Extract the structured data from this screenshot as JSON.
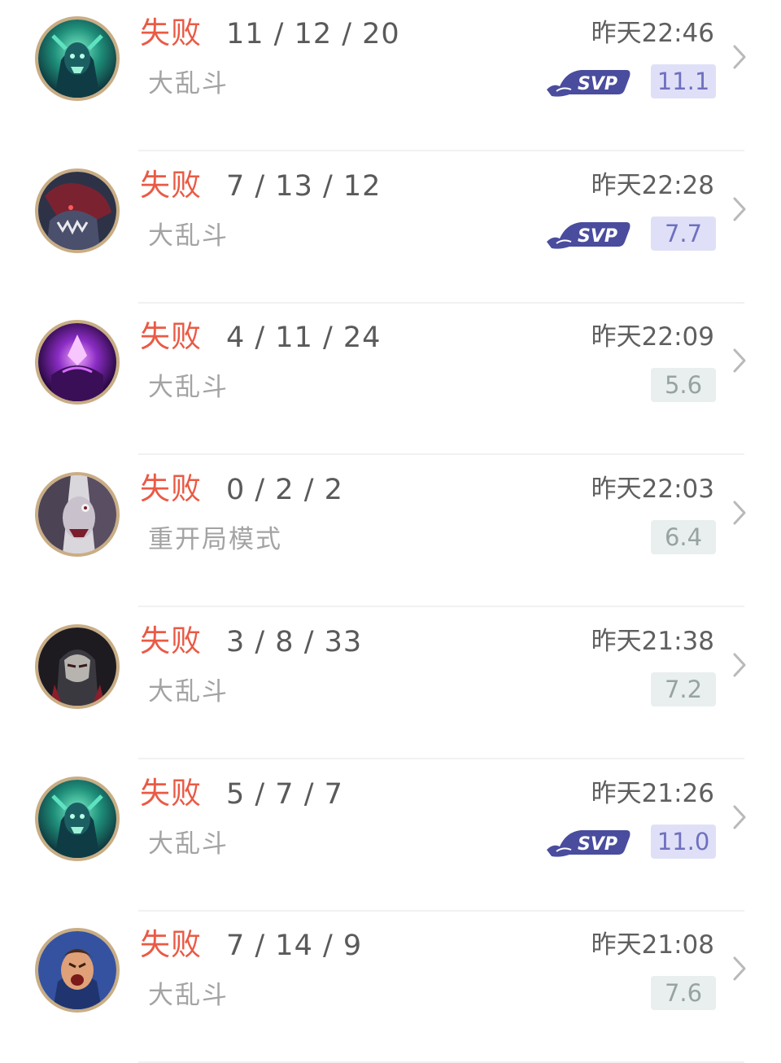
{
  "matches": [
    {
      "result": "失败",
      "kda": "11 / 12 / 20",
      "mode": "大乱斗",
      "time": "昨天22:46",
      "score": "11.1",
      "svp": true,
      "svp_label": "SVP",
      "hero_icon": "green-undead-knight-icon"
    },
    {
      "result": "失败",
      "kda": "7 / 13 / 12",
      "mode": "大乱斗",
      "time": "昨天22:28",
      "score": "7.7",
      "svp": true,
      "svp_label": "SVP",
      "hero_icon": "red-beast-icon"
    },
    {
      "result": "失败",
      "kda": "4 / 11 / 24",
      "mode": "大乱斗",
      "time": "昨天22:09",
      "score": "5.6",
      "svp": false,
      "hero_icon": "purple-void-mage-icon"
    },
    {
      "result": "失败",
      "kda": "0 / 2 / 2",
      "mode": "重开局模式",
      "time": "昨天22:03",
      "score": "6.4",
      "svp": false,
      "hero_icon": "pale-ghoul-icon"
    },
    {
      "result": "失败",
      "kda": "3 / 8 / 33",
      "mode": "大乱斗",
      "time": "昨天21:38",
      "score": "7.2",
      "svp": false,
      "hero_icon": "masked-gunner-icon"
    },
    {
      "result": "失败",
      "kda": "5 / 7 / 7",
      "mode": "大乱斗",
      "time": "昨天21:26",
      "score": "11.0",
      "svp": true,
      "svp_label": "SVP",
      "hero_icon": "green-undead-knight-icon"
    },
    {
      "result": "失败",
      "kda": "7 / 14 / 9",
      "mode": "大乱斗",
      "time": "昨天21:08",
      "score": "7.6",
      "svp": false,
      "hero_icon": "shouting-warrior-icon"
    }
  ],
  "colors": {
    "loss": "#ea5a45",
    "svp_score_bg": "#dfe0f7",
    "svp_score_text": "#6f70bf",
    "plain_score_bg": "#e9efee",
    "plain_score_text": "#97a3a1",
    "svp_badge": "#4a4c9e",
    "avatar_ring": "#c9ad84"
  }
}
